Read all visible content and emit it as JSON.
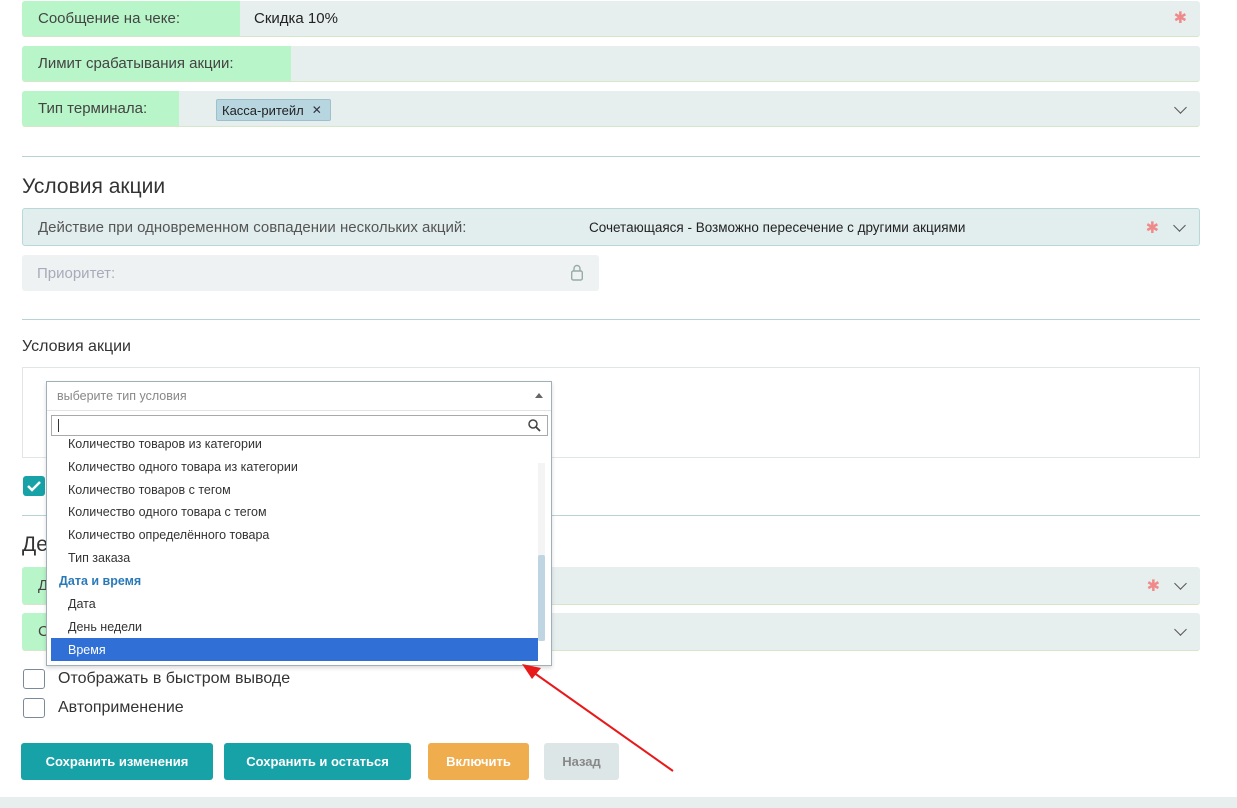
{
  "top_fields": {
    "receipt_message": {
      "label": "Сообщение на чеке:",
      "value": "Скидка 10%"
    },
    "trigger_limit": {
      "label": "Лимит срабатывания акции:",
      "value": ""
    },
    "terminal_type": {
      "label": "Тип терминала:",
      "tag": "Касса-ритейл"
    }
  },
  "conditions_section": {
    "title": "Условия акции",
    "overlap_action": {
      "label": "Действие при одновременном совпадении нескольких акций:",
      "value": "Сочетающаяся - Возможно пересечение с другими акциями"
    },
    "priority": {
      "label": "Приоритет:"
    },
    "conditions_label": "Условия акции"
  },
  "condition_dropdown": {
    "placeholder": "выберите тип условия",
    "search_value": "",
    "items": [
      {
        "label": "Количество товаров из категории",
        "type": "option"
      },
      {
        "label": "Количество одного товара из категории",
        "type": "option"
      },
      {
        "label": "Количество товаров с тегом",
        "type": "option"
      },
      {
        "label": "Количество одного товара с тегом",
        "type": "option"
      },
      {
        "label": "Количество определённого товара",
        "type": "option"
      },
      {
        "label": "Тип заказа",
        "type": "option"
      },
      {
        "label": "Дата и время",
        "type": "group"
      },
      {
        "label": "Дата",
        "type": "option"
      },
      {
        "label": "День недели",
        "type": "option"
      },
      {
        "label": "Время",
        "type": "option",
        "selected": true
      }
    ]
  },
  "partially_hidden": {
    "section_title_fragment": "Де",
    "field1_fragment": "Д",
    "field2_fragment": "С"
  },
  "checkboxes": {
    "quick_display": {
      "label": "Отображать в быстром выводе",
      "checked": false
    },
    "auto_apply": {
      "label": "Автоприменение",
      "checked": false
    }
  },
  "buttons": {
    "save_changes": "Сохранить изменения",
    "save_and_stay": "Сохранить и остаться",
    "enable": "Включить",
    "back": "Назад"
  },
  "colors": {
    "teal": "#17a2a8",
    "orange": "#f0ad4e",
    "label_green": "#b8f5c8",
    "selected_blue": "#2f6fd6",
    "arrow_red": "#e8191a"
  }
}
